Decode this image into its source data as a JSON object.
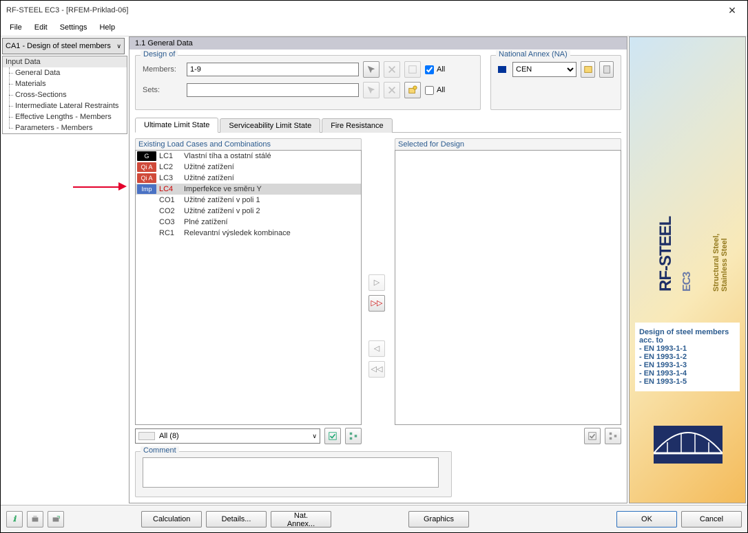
{
  "window": {
    "title": "RF-STEEL EC3 - [RFEM-Priklad-06]"
  },
  "menu": {
    "file": "File",
    "edit": "Edit",
    "settings": "Settings",
    "help": "Help"
  },
  "case_combo": "CA1 - Design of steel members",
  "content_header": "1.1 General Data",
  "tree": {
    "header": "Input Data",
    "items": [
      "General Data",
      "Materials",
      "Cross-Sections",
      "Intermediate Lateral Restraints",
      "Effective Lengths - Members",
      "Parameters - Members"
    ]
  },
  "design_of": {
    "legend": "Design of",
    "members_label": "Members:",
    "members_value": "1-9",
    "sets_label": "Sets:",
    "sets_value": "",
    "all_members_label": "All",
    "all_sets_label": "All",
    "all_members_checked": true,
    "all_sets_checked": false
  },
  "na": {
    "legend": "National Annex (NA)",
    "value": "CEN"
  },
  "tabs": {
    "uls": "Ultimate Limit State",
    "sls": "Serviceability Limit State",
    "fire": "Fire Resistance"
  },
  "lists": {
    "existing_label": "Existing Load Cases and Combinations",
    "selected_label": "Selected for Design",
    "filter_value": "All (8)"
  },
  "load_cases": [
    {
      "badge": "G",
      "badge_cls": "g",
      "id": "LC1",
      "selected": false,
      "id_red": false,
      "desc": "Vlastní tíha a ostatní stálé"
    },
    {
      "badge": "Qi A",
      "badge_cls": "qia",
      "id": "LC2",
      "selected": false,
      "id_red": false,
      "desc": "Užitné zatížení"
    },
    {
      "badge": "Qi A",
      "badge_cls": "qia",
      "id": "LC3",
      "selected": false,
      "id_red": false,
      "desc": "Užitné zatížení"
    },
    {
      "badge": "Imp",
      "badge_cls": "imp",
      "id": "LC4",
      "selected": true,
      "id_red": true,
      "desc": "Imperfekce ve směru Y"
    },
    {
      "badge": "",
      "badge_cls": "none",
      "id": "CO1",
      "selected": false,
      "id_red": false,
      "desc": "Užitné zatížení v poli 1"
    },
    {
      "badge": "",
      "badge_cls": "none",
      "id": "CO2",
      "selected": false,
      "id_red": false,
      "desc": "Užitné zatížení v poli 2"
    },
    {
      "badge": "",
      "badge_cls": "none",
      "id": "CO3",
      "selected": false,
      "id_red": false,
      "desc": "Plné zatížení"
    },
    {
      "badge": "",
      "badge_cls": "none",
      "id": "RC1",
      "selected": false,
      "id_red": false,
      "desc": "Relevantní výsledek kombinace"
    }
  ],
  "comment": {
    "legend": "Comment",
    "value": ""
  },
  "rightpanel": {
    "title": "RF-STEEL",
    "ec3": "EC3",
    "tagline": "Structural Steel,\nStainless Steel",
    "info_t1": "Design of steel members acc. to",
    "en": [
      "- EN 1993-1-1",
      "- EN 1993-1-2",
      "- EN 1993-1-3",
      "- EN 1993-1-4",
      "- EN 1993-1-5"
    ]
  },
  "buttons": {
    "calculation": "Calculation",
    "details": "Details...",
    "natannex": "Nat. Annex...",
    "graphics": "Graphics",
    "ok": "OK",
    "cancel": "Cancel"
  }
}
